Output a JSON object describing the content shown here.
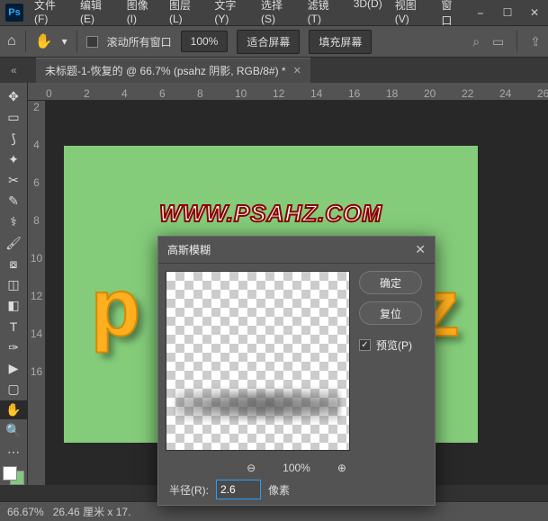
{
  "menubar": {
    "file": "文件(F)",
    "edit": "编辑(E)",
    "image": "图像(I)",
    "layer": "图层(L)",
    "type": "文字(Y)",
    "select": "选择(S)",
    "filter": "滤镜(T)",
    "threeD": "3D(D)",
    "view": "视图(V)",
    "window": "窗口"
  },
  "options": {
    "scrollAll": "滚动所有窗口",
    "zoom": "100%",
    "fitScreen": "适合屏幕",
    "fillScreen": "填充屏幕"
  },
  "doc": {
    "tab": "未标题-1-恢复的 @ 66.7% (psahz 阴影, RGB/8#) *"
  },
  "ruler": {
    "h": [
      "0",
      "2",
      "4",
      "6",
      "8",
      "10",
      "12",
      "14",
      "16",
      "18",
      "20",
      "22",
      "24",
      "26"
    ],
    "v": [
      "2",
      "4",
      "6",
      "8",
      "10",
      "12",
      "14",
      "16"
    ]
  },
  "canvas": {
    "urlText": "WWW.PSAHZ.COM",
    "letter1": "p",
    "letter2": "z"
  },
  "dialog": {
    "title": "高斯模糊",
    "ok": "确定",
    "reset": "复位",
    "preview": "预览(P)",
    "previewZoom": "100%",
    "radiusLabel": "半径(R):",
    "radiusValue": "2.6",
    "radiusUnit": "像素"
  },
  "status": {
    "zoom": "66.67%",
    "info": "26.46 厘米 x 17."
  },
  "icons": {
    "minus": "⎯",
    "square": "☐",
    "close": "✕",
    "home": "⌂",
    "hand": "✋",
    "search": "⌕",
    "panel": "▭",
    "share": "⇪",
    "collapse": "«",
    "zoomOut": "⊖",
    "zoomIn": "⊕",
    "check": "✓",
    "dropdown": "▾"
  }
}
